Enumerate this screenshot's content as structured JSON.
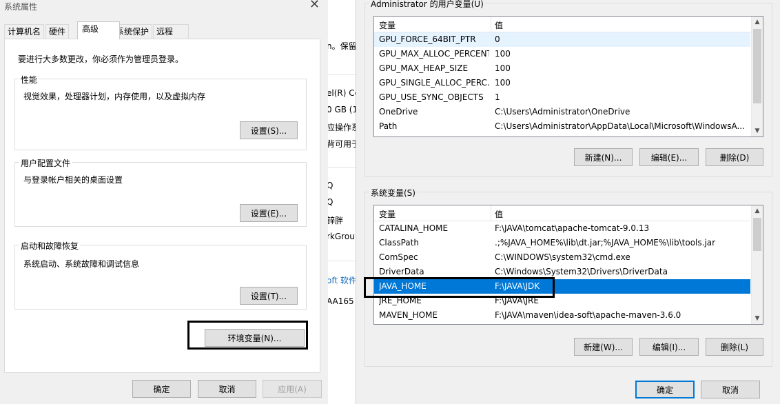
{
  "system_properties": {
    "title": "系统属性",
    "tabs": [
      "计算机名",
      "硬件",
      "高级",
      "系统保护",
      "远程"
    ],
    "notice": "要进行大多数更改，你必须作为管理员登录。",
    "performance": {
      "label": "性能",
      "desc": "视觉效果，处理器计划，内存使用，以及虚拟内存",
      "button": "设置(S)..."
    },
    "user_profiles": {
      "label": "用户配置文件",
      "desc": "与登录帐户相关的桌面设置",
      "button": "设置(E)..."
    },
    "startup_recovery": {
      "label": "启动和故障恢复",
      "desc": "系统启动、系统故障和调试信息",
      "button": "设置(T)..."
    },
    "env_button": "环境变量(N)...",
    "ok": "确定",
    "cancel": "取消",
    "apply": "应用(A)"
  },
  "background_window": {
    "lines": [
      "n。保留",
      "el(R) Co",
      "0 GB (1",
      "应操作系",
      "背可用于",
      "Q",
      "Q",
      "锌胖",
      "rkGrou",
      "oft 软件",
      "AA165"
    ]
  },
  "environment_variables": {
    "user_vars": {
      "label": "Administrator 的用户变量(U)",
      "headers": [
        "变量",
        "值"
      ],
      "rows": [
        [
          "GPU_FORCE_64BIT_PTR",
          "0"
        ],
        [
          "GPU_MAX_ALLOC_PERCENT",
          "100"
        ],
        [
          "GPU_MAX_HEAP_SIZE",
          "100"
        ],
        [
          "GPU_SINGLE_ALLOC_PERC...",
          "100"
        ],
        [
          "GPU_USE_SYNC_OBJECTS",
          "1"
        ],
        [
          "OneDrive",
          "C:\\Users\\Administrator\\OneDrive"
        ],
        [
          "Path",
          "C:\\Users\\Administrator\\AppData\\Local\\Microsoft\\WindowsA..."
        ]
      ],
      "buttons": [
        "新建(N)...",
        "编辑(E)...",
        "删除(D)"
      ]
    },
    "system_vars": {
      "label": "系统变量(S)",
      "headers": [
        "变量",
        "值"
      ],
      "rows": [
        [
          "CATALINA_HOME",
          "F:\\JAVA\\tomcat\\apache-tomcat-9.0.13"
        ],
        [
          "ClassPath",
          ".;%JAVA_HOME%\\lib\\dt.jar;%JAVA_HOME%\\lib\\tools.jar"
        ],
        [
          "ComSpec",
          "C:\\WINDOWS\\system32\\cmd.exe"
        ],
        [
          "DriverData",
          "C:\\Windows\\System32\\Drivers\\DriverData"
        ],
        [
          "JAVA_HOME",
          "F:\\JAVA\\JDK"
        ],
        [
          "JRE_HOME",
          "F:\\JAVA\\JRE"
        ],
        [
          "MAVEN_HOME",
          "F:\\JAVA\\maven\\idea-soft\\apache-maven-3.6.0"
        ]
      ],
      "selected_index": 4,
      "buttons": [
        "新建(W)...",
        "编辑(I)...",
        "删除(L)"
      ]
    },
    "ok": "确定",
    "cancel": "取消"
  },
  "colors": {
    "selection": "#0078d7",
    "window_bg": "#f0f0f0",
    "highlight_border": "#000000"
  }
}
